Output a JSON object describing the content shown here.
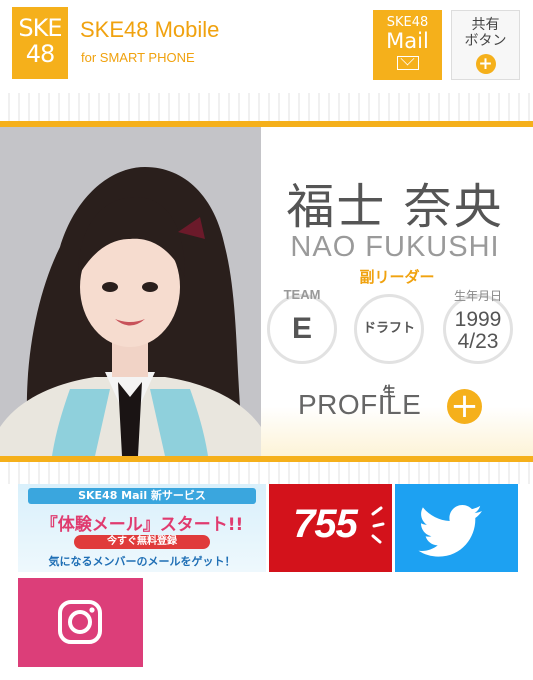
{
  "header": {
    "logo_line1": "SKE",
    "logo_line2": "48",
    "title": "SKE48 Mobile",
    "subtitle": "for SMART PHONE",
    "mail_button": {
      "line1": "SKE48",
      "line2": "Mail",
      "icon": "envelope-icon"
    },
    "share_button": {
      "line1": "共有",
      "line2": "ボタン",
      "plus": "+"
    }
  },
  "member": {
    "name_jp": "福士 奈央",
    "name_en": "NAO FUKUSHI",
    "role": "副リーダー",
    "team_caption": "TEAM",
    "team": "E",
    "draft": "ドラフト生",
    "birth_caption": "生年月日",
    "birth_year": "1999",
    "birth_date": "4/23",
    "profile_label": "PROFILE",
    "profile_plus": "+"
  },
  "banners": {
    "mail": {
      "top": "SKE48 Mail 新サービス",
      "main": "『体験メール』スタート!!",
      "button": "今すぐ無料登録",
      "bottom": "気になるメンバーのメールをゲット！"
    },
    "app_755": "755",
    "twitter": "twitter-icon",
    "instagram": "instagram-icon"
  },
  "colors": {
    "brand_yellow": "#f5b01b",
    "red_755": "#d3121b",
    "twitter_blue": "#1da1f2",
    "instagram_pink": "#dc3e79"
  }
}
